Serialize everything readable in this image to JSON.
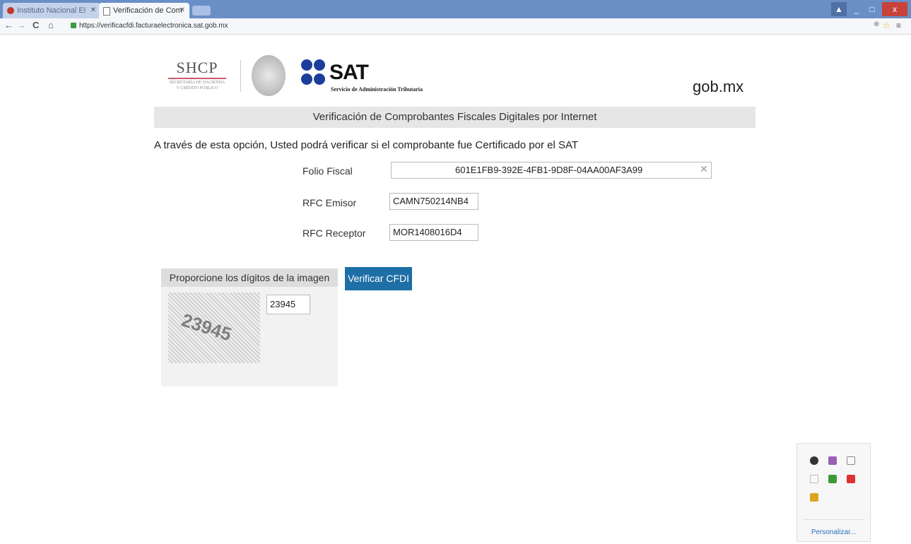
{
  "browser": {
    "tabs": [
      {
        "label": "Instituto Nacional El",
        "active": false
      },
      {
        "label": "Verificación de Com",
        "active": true
      }
    ],
    "url": "https://verificacfdi.facturaelectronica.sat.gob.mx",
    "window_controls": {
      "minimize": "_",
      "maximize": "□",
      "close": "x"
    }
  },
  "header": {
    "shcp_title": "SHCP",
    "shcp_subtitle_1": "SECRETARÍA DE HACIENDA",
    "shcp_subtitle_2": "Y CRÉDITO PÚBLICO",
    "sat_title": "SAT",
    "sat_subtitle": "Servicio de Administración Tributaria",
    "gob": "gob.mx"
  },
  "banner": "Verificación de Comprobantes Fiscales Digitales por Internet",
  "intro": "A través de esta opción, Usted podrá verificar si el comprobante fue Certificado por el SAT",
  "form": {
    "folio_label": "Folio Fiscal",
    "folio_value": "601E1FB9-392E-4FB1-9D8F-04AA00AF3A99",
    "rfc_emisor_label": "RFC Emisor",
    "rfc_emisor_value": "CAMN750214NB4",
    "rfc_receptor_label": "RFC Receptor",
    "rfc_receptor_value": "MOR1408016D4"
  },
  "captcha": {
    "heading": "Proporcione los dígitos de la imagen",
    "image_text": "23945",
    "input_value": "23945"
  },
  "verify_button": "Verificar CFDI",
  "tray": {
    "customize_link": "Personalizar..."
  }
}
